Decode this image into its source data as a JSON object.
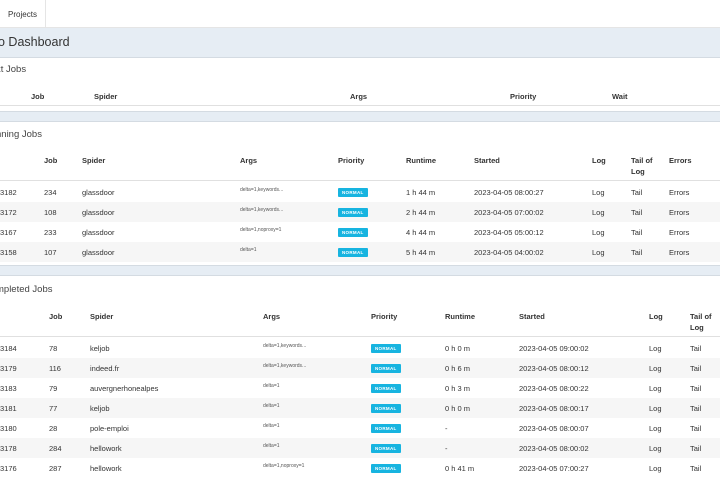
{
  "nav": {
    "projects_tab": "Projects"
  },
  "header": {
    "title": "o Dashboard"
  },
  "next_jobs": {
    "title": "xt Jobs",
    "columns": {
      "job": "Job",
      "spider": "Spider",
      "args": "Args",
      "priority": "Priority",
      "wait": "Wait"
    }
  },
  "running_jobs": {
    "title": "nning Jobs",
    "columns": {
      "job": "Job",
      "spider": "Spider",
      "args": "Args",
      "priority": "Priority",
      "runtime": "Runtime",
      "started": "Started",
      "log": "Log",
      "tail": "Tail of Log",
      "errors": "Errors"
    },
    "rows": [
      {
        "id": "3182",
        "job": "234",
        "spider": "glassdoor",
        "args": "delta=1,keywords...",
        "priority": "NORMAL",
        "runtime": "1 h 44 m",
        "started": "2023-04-05 08:00:27",
        "log": "Log",
        "tail": "Tail",
        "errors": "Errors"
      },
      {
        "id": "3172",
        "job": "108",
        "spider": "glassdoor",
        "args": "delta=1,keywords...",
        "priority": "NORMAL",
        "runtime": "2 h 44 m",
        "started": "2023-04-05 07:00:02",
        "log": "Log",
        "tail": "Tail",
        "errors": "Errors"
      },
      {
        "id": "3167",
        "job": "233",
        "spider": "glassdoor",
        "args": "delta=1,noproxy=1",
        "priority": "NORMAL",
        "runtime": "4 h 44 m",
        "started": "2023-04-05 05:00:12",
        "log": "Log",
        "tail": "Tail",
        "errors": "Errors"
      },
      {
        "id": "3158",
        "job": "107",
        "spider": "glassdoor",
        "args": "delta=1",
        "priority": "NORMAL",
        "runtime": "5 h 44 m",
        "started": "2023-04-05 04:00:02",
        "log": "Log",
        "tail": "Tail",
        "errors": "Errors"
      }
    ]
  },
  "completed_jobs": {
    "title": "mpleted Jobs",
    "columns": {
      "job": "Job",
      "spider": "Spider",
      "args": "Args",
      "priority": "Priority",
      "runtime": "Runtime",
      "started": "Started",
      "log": "Log",
      "tail": "Tail of Log"
    },
    "rows": [
      {
        "id": "3184",
        "job": "78",
        "spider": "keljob",
        "args": "delta=1,keywords...",
        "priority": "NORMAL",
        "runtime": "0 h 0 m",
        "started": "2023-04-05 09:00:02",
        "log": "Log",
        "tail": "Tail"
      },
      {
        "id": "3179",
        "job": "116",
        "spider": "indeed.fr",
        "args": "delta=1,keywords...",
        "priority": "NORMAL",
        "runtime": "0 h 6 m",
        "started": "2023-04-05 08:00:12",
        "log": "Log",
        "tail": "Tail"
      },
      {
        "id": "3183",
        "job": "79",
        "spider": "auvergnerhonealpes",
        "args": "delta=1",
        "priority": "NORMAL",
        "runtime": "0 h 3 m",
        "started": "2023-04-05 08:00:22",
        "log": "Log",
        "tail": "Tail"
      },
      {
        "id": "3181",
        "job": "77",
        "spider": "keljob",
        "args": "delta=1",
        "priority": "NORMAL",
        "runtime": "0 h 0 m",
        "started": "2023-04-05 08:00:17",
        "log": "Log",
        "tail": "Tail"
      },
      {
        "id": "3180",
        "job": "28",
        "spider": "pole-emploi",
        "args": "delta=1",
        "priority": "NORMAL",
        "runtime": "-",
        "started": "2023-04-05 08:00:07",
        "log": "Log",
        "tail": "Tail"
      },
      {
        "id": "3178",
        "job": "284",
        "spider": "hellowork",
        "args": "delta=1",
        "priority": "NORMAL",
        "runtime": "-",
        "started": "2023-04-05 08:00:02",
        "log": "Log",
        "tail": "Tail"
      },
      {
        "id": "3176",
        "job": "287",
        "spider": "hellowork",
        "args": "delta=1,noproxy=1",
        "priority": "NORMAL",
        "runtime": "0 h 41 m",
        "started": "2023-04-05 07:00:27",
        "log": "Log",
        "tail": "Tail"
      }
    ]
  }
}
